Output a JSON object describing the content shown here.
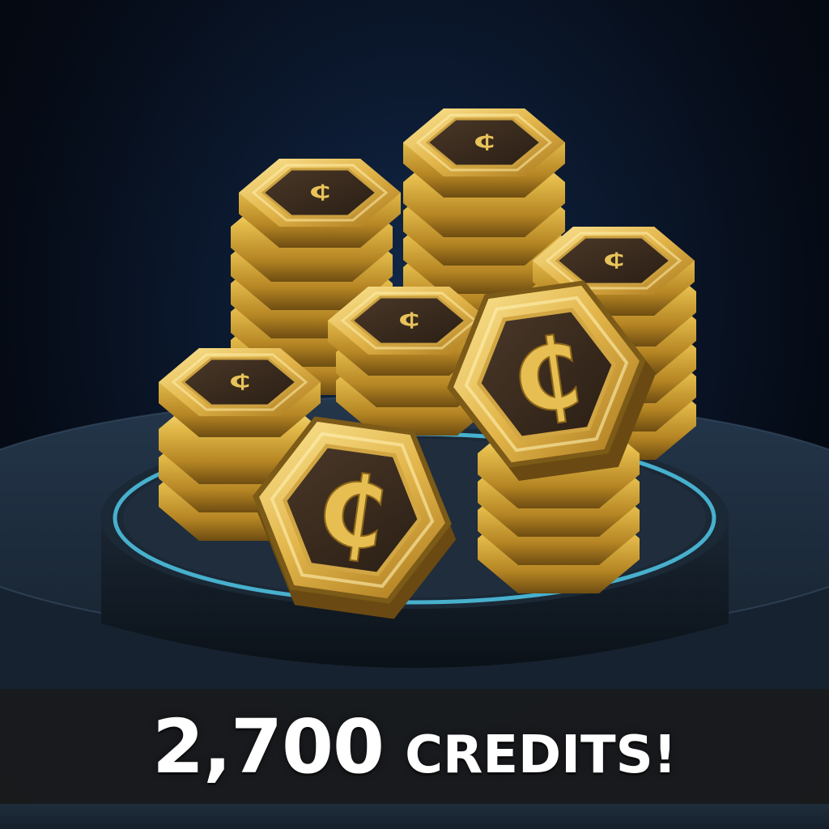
{
  "banner": {
    "amount": "2,700",
    "label": "CREDITS!"
  },
  "coin": {
    "symbol": "₵"
  },
  "colors": {
    "gold": "#e0b84a",
    "gold_light": "#f7df8a",
    "gold_dark": "#8a6418",
    "coin_face": "#3b2c1f",
    "pedestal": "#1d2b3b",
    "ring_glow": "#4fc8e8",
    "banner_bg": "#1a1c1e",
    "text": "#ffffff"
  }
}
